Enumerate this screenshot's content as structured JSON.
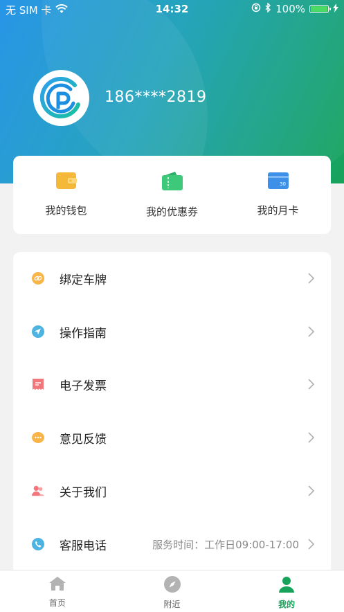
{
  "status_bar": {
    "carrier": "无 SIM 卡",
    "time": "14:32",
    "battery": "100%"
  },
  "profile": {
    "phone": "186****2819"
  },
  "quick_actions": [
    {
      "label": "我的钱包",
      "icon": "wallet-icon",
      "color": "#f5b93a"
    },
    {
      "label": "我的优惠券",
      "icon": "coupon-icon",
      "color": "#3ec97a"
    },
    {
      "label": "我的月卡",
      "icon": "monthly-card-icon",
      "color": "#3d8fe8"
    }
  ],
  "menu": [
    {
      "label": "绑定车牌",
      "icon": "link-icon",
      "color": "#f7b54a",
      "extra": ""
    },
    {
      "label": "操作指南",
      "icon": "navigation-icon",
      "color": "#4db3e0",
      "extra": ""
    },
    {
      "label": "电子发票",
      "icon": "invoice-icon",
      "color": "#f0787c",
      "extra": ""
    },
    {
      "label": "意见反馈",
      "icon": "chat-icon",
      "color": "#f7b54a",
      "extra": ""
    },
    {
      "label": "关于我们",
      "icon": "users-icon",
      "color": "#f0787c",
      "extra": ""
    },
    {
      "label": "客服电话",
      "icon": "phone-icon",
      "color": "#4db3e0",
      "extra": "服务时间：工作日09:00-17:00"
    }
  ],
  "tabs": [
    {
      "label": "首页",
      "icon": "home-icon",
      "active": false
    },
    {
      "label": "附近",
      "icon": "compass-icon",
      "active": false
    },
    {
      "label": "我的",
      "icon": "profile-icon",
      "active": true
    }
  ],
  "colors": {
    "accent": "#17a35a",
    "header_start": "#1b8fe6",
    "header_end": "#17a35a"
  }
}
